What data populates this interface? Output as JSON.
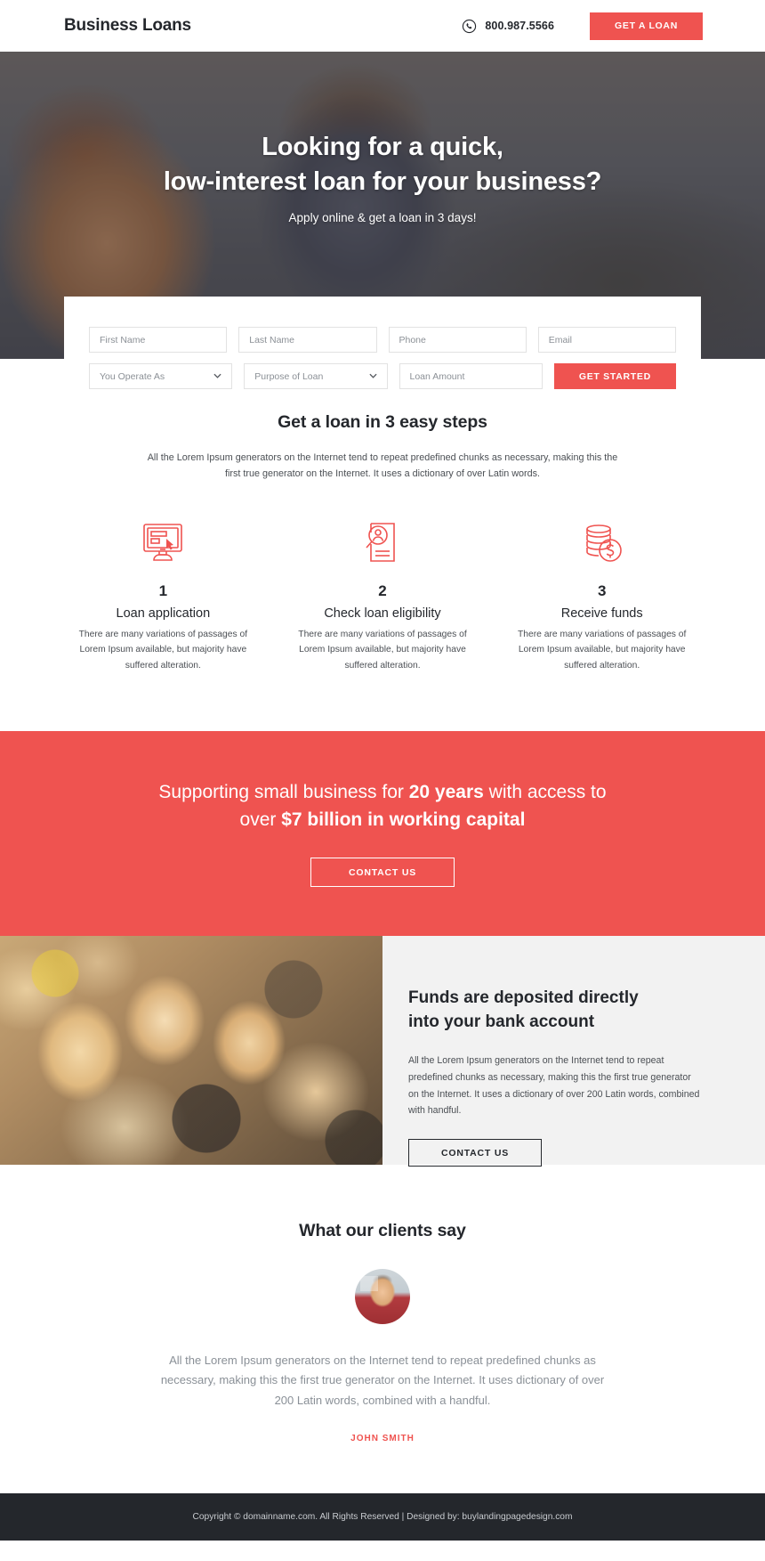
{
  "header": {
    "brand": "Business Loans",
    "phone": "800.987.5566",
    "phone_icon": "phone-circle-icon",
    "cta_label": "GET A LOAN"
  },
  "hero": {
    "title_line1": "Looking for a quick,",
    "title_line2": "low-interest loan for your business?",
    "subtitle": "Apply online & get a loan in 3 days!"
  },
  "form": {
    "first_name_placeholder": "First Name",
    "last_name_placeholder": "Last Name",
    "phone_placeholder": "Phone",
    "email_placeholder": "Email",
    "operate_as_label": "You Operate As",
    "purpose_label": "Purpose of Loan",
    "loan_amount_placeholder": "Loan Amount",
    "submit_label": "GET STARTED",
    "chevron": "⌄"
  },
  "steps_section": {
    "title": "Get a loan in 3 easy steps",
    "subtitle": "All the Lorem Ipsum generators on the Internet tend to repeat predefined chunks as necessary, making this the first true generator on the Internet. It uses a dictionary of over Latin words.",
    "steps": [
      {
        "number": "1",
        "title": "Loan application",
        "desc": "There are many variations of passages of Lorem Ipsum available, but majority have suffered alteration.",
        "icon": "monitor-cursor-icon"
      },
      {
        "number": "2",
        "title": "Check loan eligibility",
        "desc": "There are many variations of passages of Lorem Ipsum available, but majority have suffered alteration.",
        "icon": "document-magnifier-person-icon"
      },
      {
        "number": "3",
        "title": "Receive funds",
        "desc": "There are many variations of passages of Lorem Ipsum available, but majority have suffered alteration.",
        "icon": "coins-dollar-icon"
      }
    ]
  },
  "cta_band": {
    "line1_a": "Supporting small business for ",
    "line1_b": "20 years",
    "line1_c": " with access to",
    "line2_a": "over ",
    "line2_b": "$7 billion in working capital",
    "button_label": "CONTACT US"
  },
  "funds": {
    "title_line1": "Funds are deposited directly",
    "title_line2": "into your bank account",
    "body": "All the Lorem Ipsum generators on the Internet tend to repeat predefined chunks as necessary, making this the first true generator on the Internet. It uses a dictionary of over 200 Latin words, combined with handful.",
    "button_label": "CONTACT US",
    "photo": "crowd-thumbs-up-photo"
  },
  "testimonial": {
    "title": "What our clients say",
    "avatar": "client-avatar-photo",
    "quote": "All the Lorem Ipsum generators on the Internet tend to repeat predefined chunks as necessary, making this the first true generator on the Internet. It uses dictionary of over 200 Latin words, combined with a handful.",
    "author": "JOHN SMITH"
  },
  "footer": {
    "text": "Copyright © domainname.com. All Rights Reserved | Designed by: buylandingpagedesign.com"
  },
  "colors": {
    "accent": "#ef5350",
    "dark": "#24272c",
    "light_gray": "#f2f2f2"
  }
}
